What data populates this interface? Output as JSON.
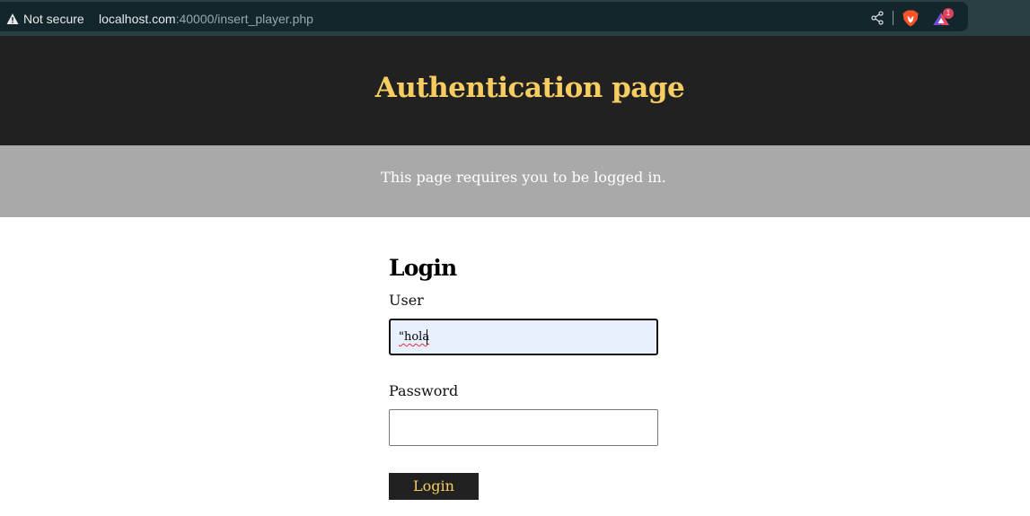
{
  "browser": {
    "security_label": "Not secure",
    "url_host": "localhost.com",
    "url_path": ":40000/insert_player.php",
    "rewards_badge_count": "1",
    "icons": [
      "warning-icon",
      "share-icon",
      "brave-lion-icon",
      "brave-rewards-icon"
    ]
  },
  "header": {
    "title": "Authentication page",
    "title_color": "#f7cd61",
    "background": "#212121"
  },
  "notice": {
    "text": "This page requires you to be logged in.",
    "background": "#a9a9a9"
  },
  "login": {
    "heading": "Login",
    "user_label": "User",
    "user_value": "\"hola",
    "password_label": "Password",
    "password_value": "",
    "submit_label": "Login"
  }
}
